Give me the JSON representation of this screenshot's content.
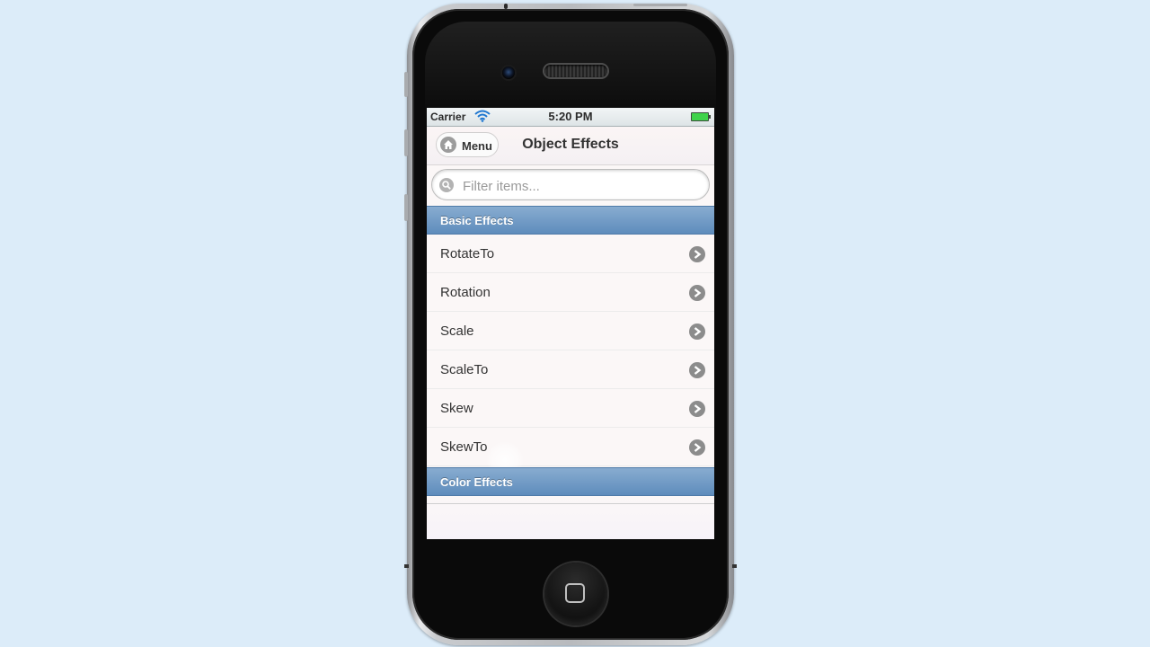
{
  "status_bar": {
    "carrier": "Carrier",
    "time": "5:20 PM",
    "wifi_icon": "wifi-icon",
    "battery_icon": "battery-icon",
    "battery_color": "#3fd34a"
  },
  "header": {
    "menu_label": "Menu",
    "menu_icon": "home-icon",
    "title": "Object Effects"
  },
  "search": {
    "placeholder": "Filter items...",
    "value": "",
    "icon": "search-icon"
  },
  "sections": [
    {
      "title": "Basic Effects",
      "items": [
        "RotateTo",
        "Rotation",
        "Scale",
        "ScaleTo",
        "Skew",
        "SkewTo"
      ]
    },
    {
      "title": "Color Effects",
      "items": []
    }
  ],
  "colors": {
    "divider": "#6f9bc7",
    "page_background": "#dcecf9",
    "list_background": "#fbf7f7"
  }
}
